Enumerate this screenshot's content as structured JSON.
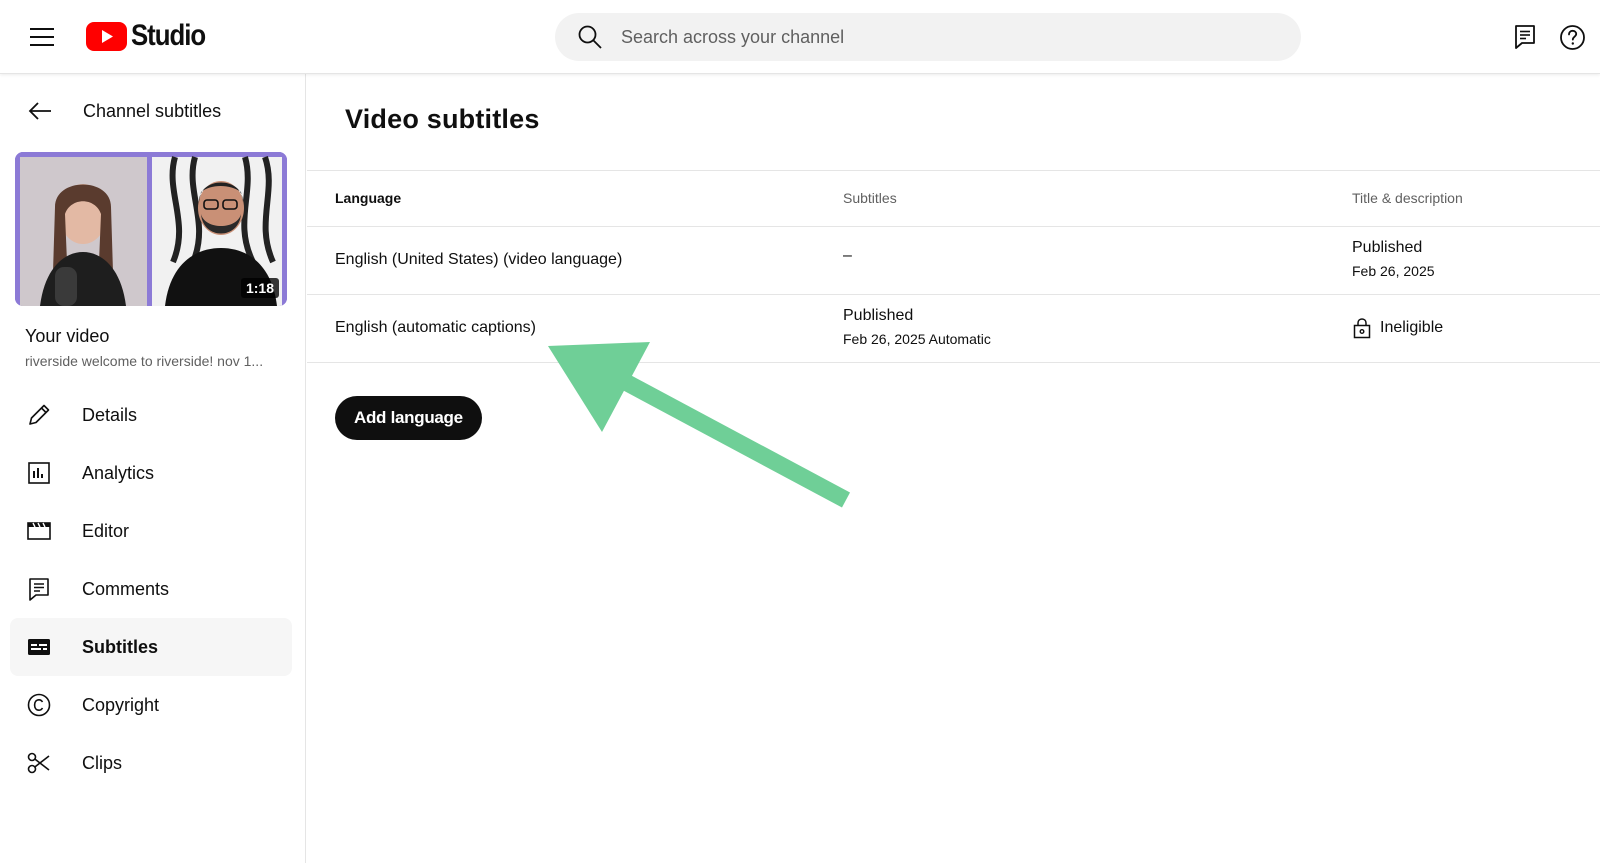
{
  "header": {
    "logo_text": "Studio",
    "search_placeholder": "Search across your channel"
  },
  "sidebar": {
    "back_label": "Channel subtitles",
    "thumbnail_duration": "1:18",
    "your_video_label": "Your video",
    "video_description": "riverside welcome to riverside! nov 1...",
    "nav": [
      {
        "label": "Details",
        "icon": "pencil-icon"
      },
      {
        "label": "Analytics",
        "icon": "analytics-icon"
      },
      {
        "label": "Editor",
        "icon": "clapper-icon"
      },
      {
        "label": "Comments",
        "icon": "comments-icon"
      },
      {
        "label": "Subtitles",
        "icon": "subtitles-icon",
        "active": true
      },
      {
        "label": "Copyright",
        "icon": "copyright-icon"
      },
      {
        "label": "Clips",
        "icon": "scissors-icon"
      }
    ]
  },
  "main": {
    "title": "Video subtitles",
    "columns": [
      "Language",
      "Subtitles",
      "Title & description"
    ],
    "rows": [
      {
        "language": "English (United States) (video language)",
        "subtitles": "–",
        "title_status": "Published",
        "title_date": "Feb 26, 2025"
      },
      {
        "language": "English (automatic captions)",
        "subtitles_status": "Published",
        "subtitles_date": "Feb 26, 2025 Automatic",
        "title_status": "Ineligible"
      }
    ],
    "add_language_label": "Add language"
  },
  "colors": {
    "brand_red": "#ff0000",
    "annotation_arrow": "#6fcf97",
    "thumbnail_accent": "#8c7ad6"
  }
}
